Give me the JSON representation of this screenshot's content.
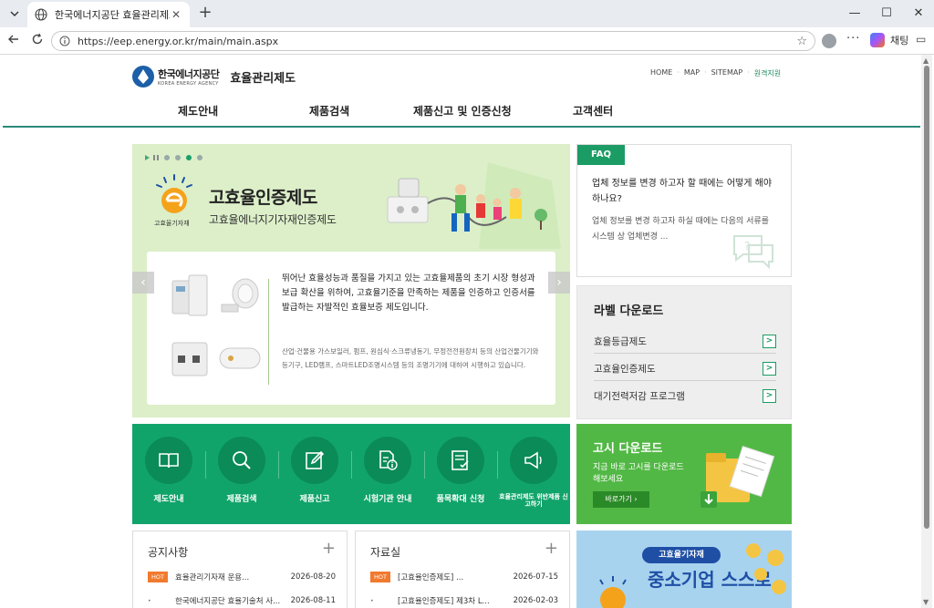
{
  "browser": {
    "tab_title": "한국에너지공단 효율관리제도",
    "url": "https://eep.energy.or.kr/main/main.aspx",
    "chat_label": "채팅",
    "minimize": "—",
    "maximize": "☐",
    "close": "✕"
  },
  "header": {
    "logo_ko": "한국에너지공단",
    "logo_en": "KOREA ENERGY AGENCY",
    "site_name": "효율관리제도",
    "links": [
      "HOME",
      "MAP",
      "SITEMAP"
    ],
    "remote": "원격지원"
  },
  "gnb": [
    "제도안내",
    "제품검색",
    "제품신고 및 인증신청",
    "고객센터"
  ],
  "hero": {
    "emblem_label": "고효율기자재",
    "title": "고효율인증제도",
    "subtitle": "고효율에너지기자재인증제도",
    "desc": "뛰어난 효율성능과 품질을 가지고 있는 고효율제품의 초기 시장 형성과 보급 확산을 위하여, 고효율기준을 만족하는 제품을 인증하고 인증서를 발급하는 자발적인 효율보증 제도입니다.",
    "small": "산업·건물용 가스보일러, 펌프, 원심식·스크류냉동기, 무정전전원장치 등의 산업건물기기와 등기구, LED램프, 스마트LED조명시스템 등의 조명기기에 대하여 시행하고 있습니다.",
    "prev": "‹",
    "next": "›"
  },
  "faq": {
    "tag": "FAQ",
    "question": "업체 정보를 변경 하고자 할 때에는 어떻게 해야 하나요?",
    "answer": "업체 정보를 변경 하고자 하실 때에는 다음의 서류를 시스템 상 업체변경 ..."
  },
  "labels": {
    "title": "라벨 다운로드",
    "items": [
      "효율등급제도",
      "고효율인증제도",
      "대기전력저감 프로그램"
    ]
  },
  "quick": [
    {
      "label": "제도안내",
      "icon": "book-icon"
    },
    {
      "label": "제품검색",
      "icon": "search-icon"
    },
    {
      "label": "제품신고",
      "icon": "edit-icon"
    },
    {
      "label": "시험기관 안내",
      "icon": "info-doc-icon"
    },
    {
      "label": "품목확대 신청",
      "icon": "checklist-icon"
    },
    {
      "label": "효율관리제도 위반제품 신고하기",
      "icon": "megaphone-icon"
    }
  ],
  "notice_download": {
    "title": "고시 다운로드",
    "sub": "지금 바로 고시를 다운로드 해보세요",
    "button": "바로가기"
  },
  "notices": {
    "title": "공지사항",
    "rows": [
      {
        "badge": "HOT",
        "text": "효율관리기자재 운용...",
        "date": "2026-08-20"
      },
      {
        "badge": "•",
        "text": "한국에너지공단 효율기술처 사...",
        "date": "2026-08-11"
      }
    ]
  },
  "resources": {
    "title": "자료실",
    "rows": [
      {
        "badge": "HOT",
        "text": "[고효율인증제도] ...",
        "date": "2026-07-15"
      },
      {
        "badge": "•",
        "text": "[고효율인증제도] 제3차 L...",
        "date": "2026-02-03"
      }
    ]
  },
  "banner": {
    "tag": "고효율기자재",
    "big": "중소기업 스스로"
  },
  "colors": {
    "primary_green": "#11a46a",
    "faq_green": "#1b9c64",
    "hot_orange": "#f07a2e",
    "gnb_line": "#2b8a7a",
    "notice_green": "#52b845"
  }
}
